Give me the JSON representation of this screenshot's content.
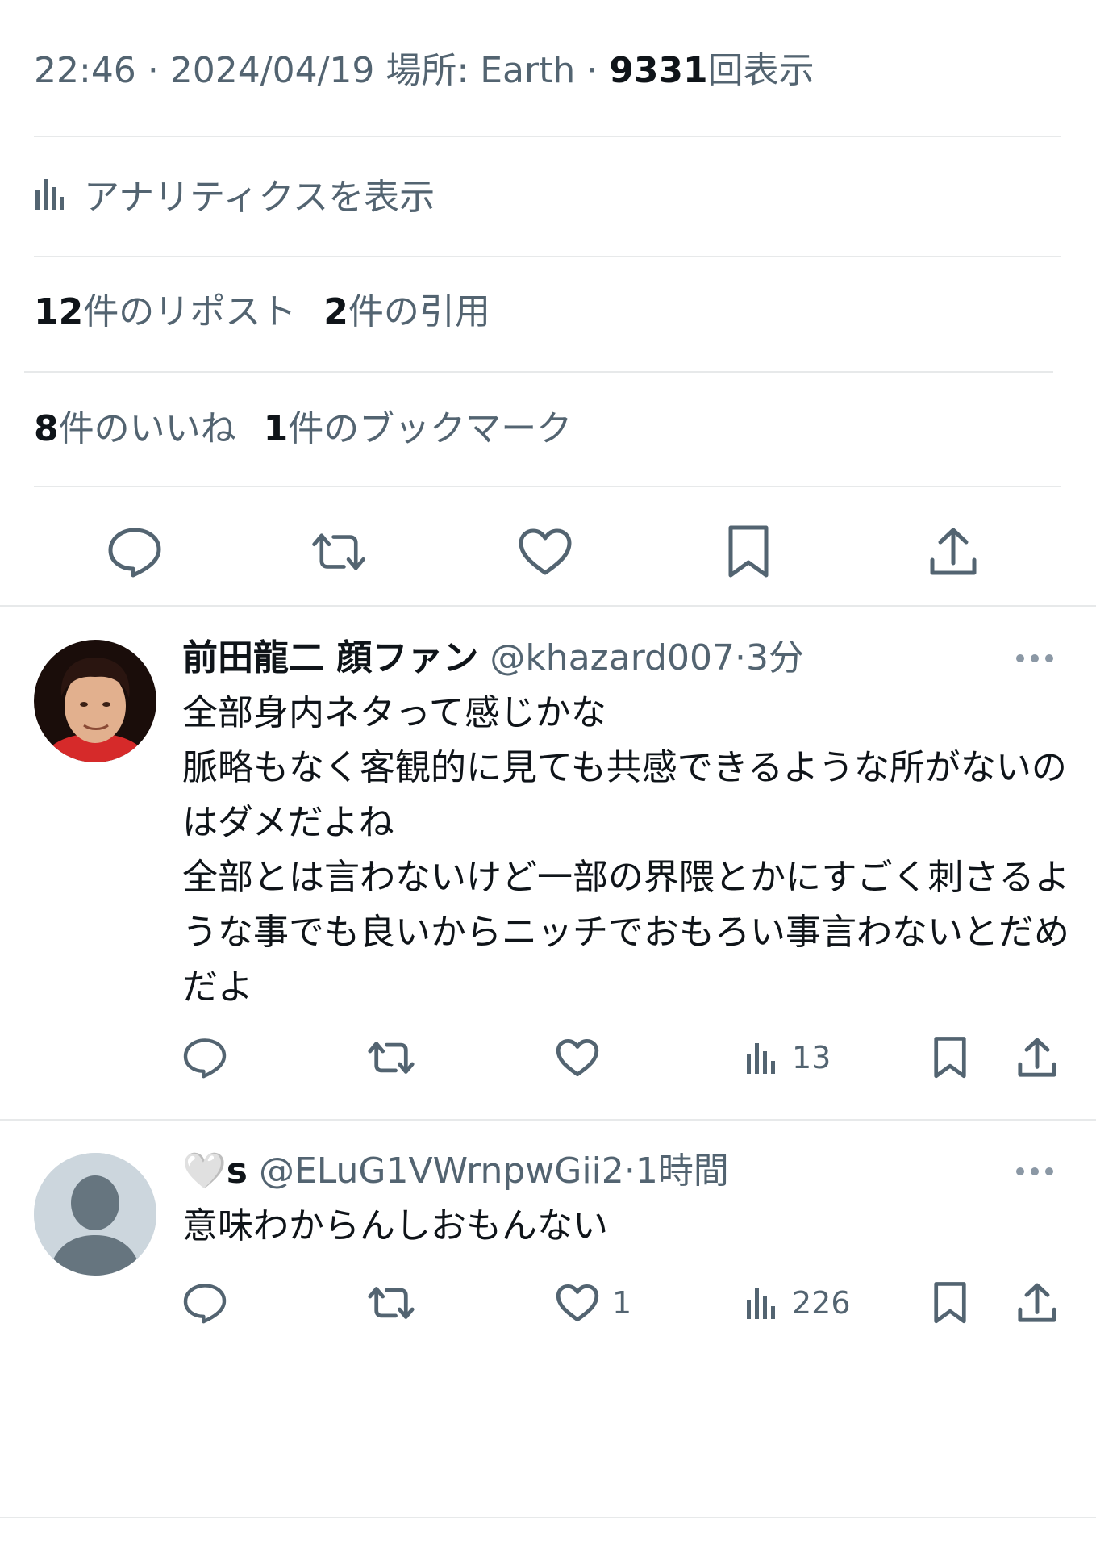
{
  "tweet_meta": {
    "time": "22:46",
    "date": "2024/04/19",
    "location_label": "場所: Earth",
    "views_count": "9331",
    "views_label": "回表示"
  },
  "analytics": {
    "label": "アナリティクスを表示"
  },
  "stats": {
    "reposts_count": "12",
    "reposts_label": "件のリポスト",
    "quotes_count": "2",
    "quotes_label": "件の引用",
    "likes_count": "8",
    "likes_label": "件のいいね",
    "bookmarks_count": "1",
    "bookmarks_label": "件のブックマーク"
  },
  "action_icons": [
    "reply-icon",
    "repost-icon",
    "like-icon",
    "bookmark-icon",
    "share-icon"
  ],
  "replies": [
    {
      "display_name": "前田龍二 顔ファン",
      "handle": "@khazard007",
      "separator": "·",
      "time": "3分",
      "text": "全部身内ネタって感じかな\n脈略もなく客観的に見ても共感できるような所がないのはダメだよね\n全部とは言わないけど一部の界隈とかにすごく刺さるような事でも良いからニッチでおもろい事言わないとだめだよ",
      "likes": "",
      "views": "13"
    },
    {
      "display_name_prefix": "🤍",
      "display_name": "s",
      "handle": "@ELuG1VWrnpwGii2",
      "separator": "·",
      "time": "1時間",
      "text": "意味わからんしおもんない",
      "likes": "1",
      "views": "226"
    }
  ],
  "colors": {
    "text": "#0f1419",
    "secondary": "#536471",
    "divider": "#e7e9ea"
  }
}
